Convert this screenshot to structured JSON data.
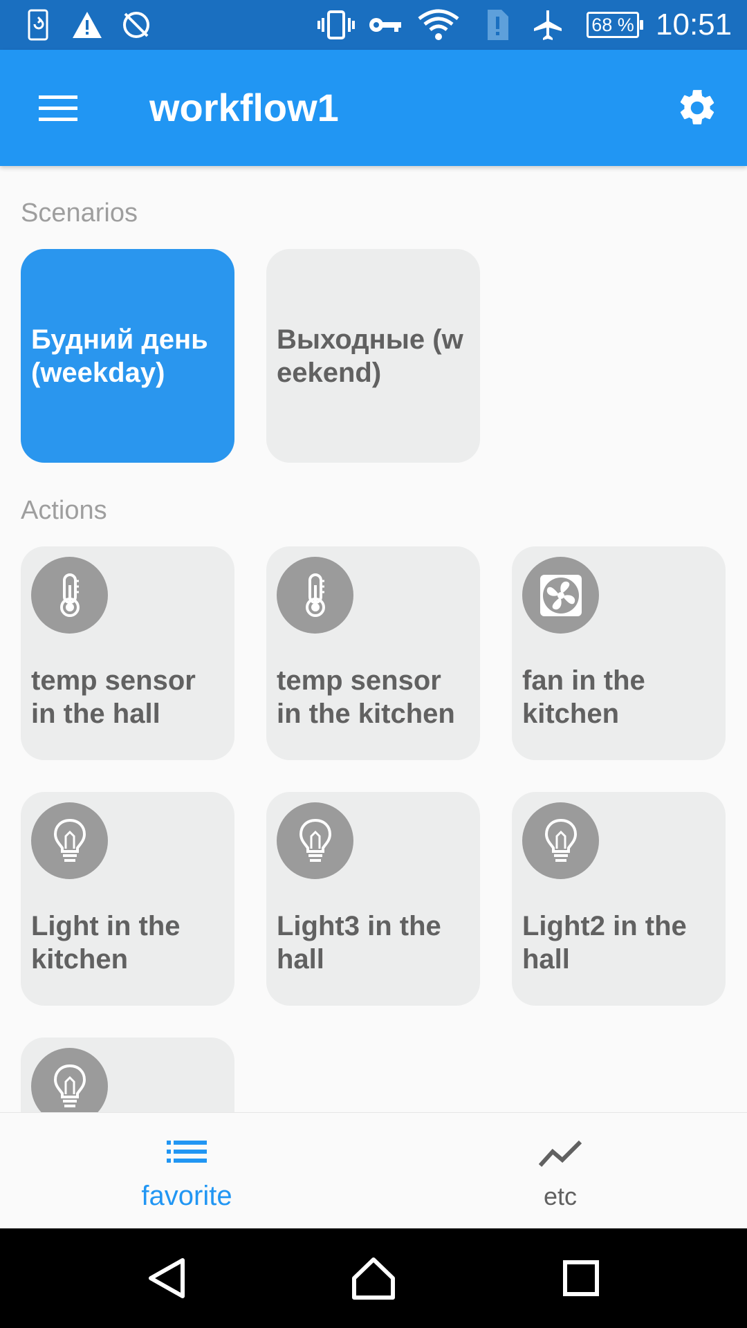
{
  "status_bar": {
    "battery_text": "68 %",
    "time": "10:51",
    "icons": [
      "sync-phone-icon",
      "warning-icon",
      "no-sync-icon",
      "vibrate-icon",
      "vpn-key-icon",
      "wifi-icon",
      "sim-alert-icon",
      "airplane-icon",
      "battery-icon"
    ]
  },
  "app_bar": {
    "title": "workflow1",
    "menu_icon": "hamburger-menu-icon",
    "settings_icon": "gear-icon"
  },
  "scenarios": {
    "label": "Scenarios",
    "items": [
      {
        "label": "Будний день(weekday)",
        "selected": true
      },
      {
        "label": "Выходные (weekend)",
        "selected": false
      }
    ]
  },
  "actions": {
    "label": "Actions",
    "items": [
      {
        "label": "temp sensor in the hall",
        "icon": "thermometer-icon"
      },
      {
        "label": "temp sensor in the kitchen",
        "icon": "thermometer-icon"
      },
      {
        "label": "fan in the kitchen",
        "icon": "fan-icon"
      },
      {
        "label": "Light in the kitchen",
        "icon": "lightbulb-icon"
      },
      {
        "label": "Light3 in the hall",
        "icon": "lightbulb-icon"
      },
      {
        "label": "Light2 in the hall",
        "icon": "lightbulb-icon"
      },
      {
        "label": "",
        "icon": "lightbulb-icon"
      }
    ]
  },
  "bottom_nav": {
    "items": [
      {
        "label": "favorite",
        "icon": "list-icon",
        "active": true
      },
      {
        "label": "etc",
        "icon": "trend-line-icon",
        "active": false
      }
    ]
  },
  "colors": {
    "primary": "#2196f3",
    "status_bar": "#1a6fc0",
    "card_bg": "#eceded",
    "icon_circle": "#9b9b9b",
    "active_nav": "#2196f3",
    "inactive_nav": "#616161"
  }
}
